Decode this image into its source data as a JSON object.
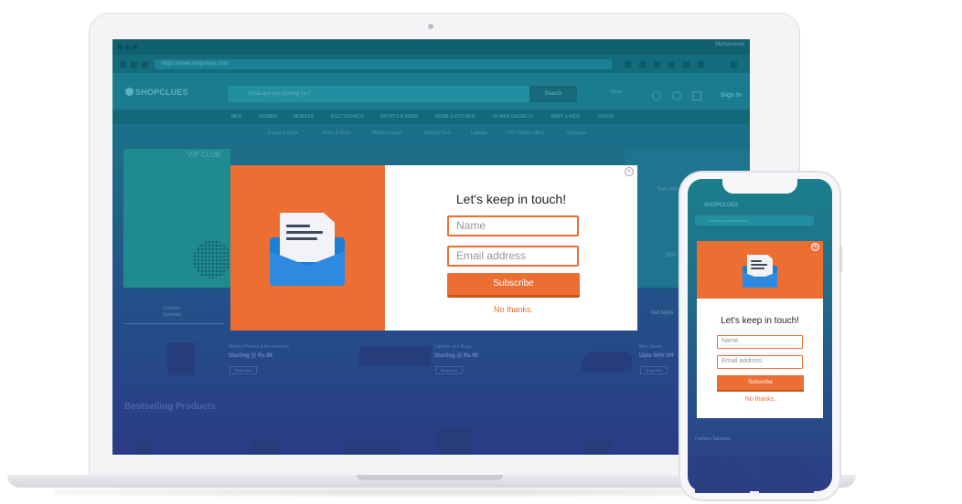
{
  "browser": {
    "user_name": "Mohammed",
    "url": "https://www.shopclues.com"
  },
  "site": {
    "logo": "SHOPCLUES",
    "search_placeholder": "What are you looking for?",
    "search_button": "Search",
    "store_link": "Store",
    "signin": "Sign In",
    "categories": [
      "MEN",
      "WOMEN",
      "MOBILES",
      "ELECTRONICS",
      "SPORTS & MORE",
      "HOME & KITCHEN",
      "HI-WEB GADGETS",
      "BABY & KIDS",
      "OFFER"
    ],
    "subcategories": [
      "Kurtas & Kurtis",
      "Tshirts & Polos",
      "Mobile phones",
      "Kitchen Tools",
      "Laptops",
      "COD Combo offers",
      "Groceries"
    ],
    "vip_banner": "VIP CLUB",
    "right_promos": [
      "Get 100",
      "20%",
      "Get Upto"
    ],
    "fashion_tab": [
      "Fashion",
      "Saturday"
    ],
    "products": [
      {
        "title": "Mobile Phones & Accessories",
        "price": "Starting @ Rs.99",
        "button": "Shop Now"
      },
      {
        "title": "Carpets and Rugs",
        "price": "Starting @ Rs.99",
        "button": "Shop Now"
      },
      {
        "title": "Men Shoes",
        "price": "Upto 50% Off",
        "button": "Shop Now"
      }
    ],
    "bestselling": "Bestselling Products"
  },
  "popup": {
    "title": "Let's keep in  touch!",
    "name_placeholder": "Name",
    "email_placeholder": "Email address",
    "subscribe_label": "Subscribe",
    "decline_label": "No thanks.",
    "close_glyph": "×"
  },
  "phone": {
    "logo": "SHOPCLUES",
    "search_placeholder": "What are you looking for?",
    "fashion_label": "Fashion Saturday",
    "popup": {
      "title": "Let's keep in  touch!",
      "name_placeholder": "Name",
      "email_placeholder": "Email address",
      "subscribe_label": "Subscribe",
      "decline_label": "No thanks.",
      "close_glyph": "×"
    }
  },
  "colors": {
    "accent": "#ec6e33",
    "overlay_top": "#177a8c",
    "overlay_bottom": "#2a3b86",
    "envelope": "#2f8be2"
  },
  "icons": [
    "envelope-icon",
    "close-icon",
    "search-icon",
    "cart-icon",
    "heart-icon"
  ]
}
